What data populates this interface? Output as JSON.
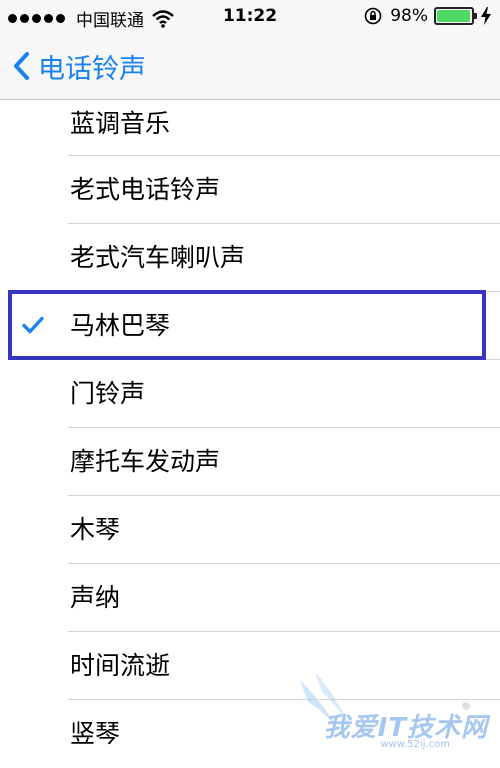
{
  "status_bar": {
    "carrier": "中国联通",
    "time": "11:22",
    "battery_percent": "98%",
    "battery_level": 0.98,
    "icons": [
      "signal-dots",
      "wifi-icon",
      "rotation-lock-icon",
      "battery-icon",
      "charging-icon"
    ]
  },
  "nav": {
    "back_label": "电话铃声",
    "back_icon": "chevron-left-icon"
  },
  "ringtones": {
    "items": [
      {
        "label": "蓝调音乐",
        "selected": false
      },
      {
        "label": "老式电话铃声",
        "selected": false
      },
      {
        "label": "老式汽车喇叭声",
        "selected": false
      },
      {
        "label": "马林巴琴",
        "selected": true
      },
      {
        "label": "门铃声",
        "selected": false
      },
      {
        "label": "摩托车发动声",
        "selected": false
      },
      {
        "label": "木琴",
        "selected": false
      },
      {
        "label": "声纳",
        "selected": false
      },
      {
        "label": "时间流逝",
        "selected": false
      },
      {
        "label": "竖琴",
        "selected": false
      }
    ]
  },
  "colors": {
    "accent": "#1a82f0",
    "highlight_box": "#3535c0",
    "battery": "#4cd964"
  },
  "watermark": {
    "text": "我爱IT技术网",
    "url": "www.52ij.com"
  }
}
